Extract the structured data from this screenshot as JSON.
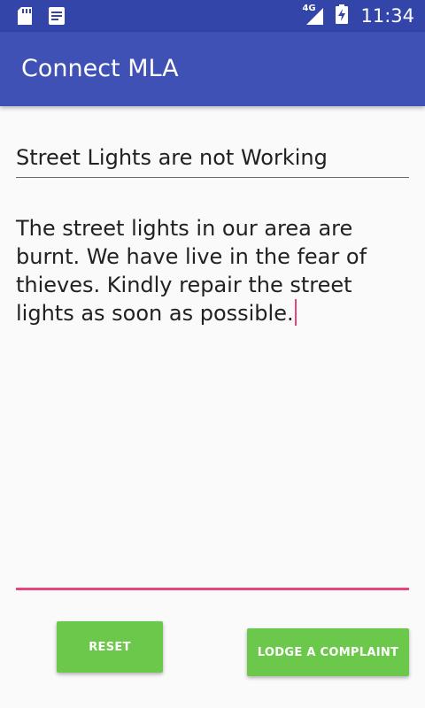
{
  "status_bar": {
    "time": "11:34",
    "network_type": "4G",
    "icons": [
      "sd-card-icon",
      "notification-document-icon",
      "signal-icon",
      "battery-charging-icon"
    ]
  },
  "app_bar": {
    "title": "Connect MLA"
  },
  "form": {
    "subject_value": "Street Lights are not Working",
    "body_value": "The street lights in our area are burnt. We have live in the fear of thieves. Kindly repair the street lights as soon as possible."
  },
  "actions": {
    "reset_label": "RESET",
    "lodge_label": "LODGE A COMPLAINT"
  },
  "colors": {
    "status_bar": "#3345a8",
    "app_bar": "#3f51b5",
    "accent": "#e8457e",
    "button": "#6cc84a",
    "background": "#fafafa"
  }
}
